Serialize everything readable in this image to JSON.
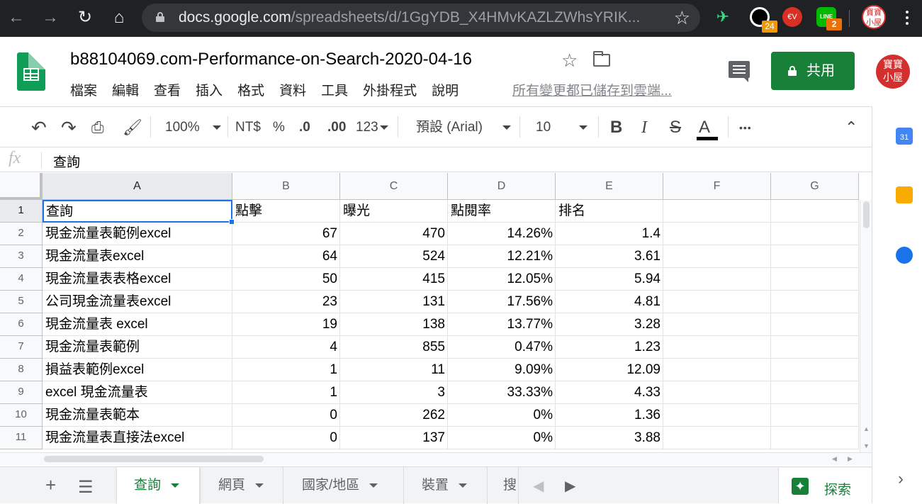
{
  "browser": {
    "url_host": "docs.google.com",
    "url_path": "/spreadsheets/d/1GgYDB_X4HMvKAZLZWhsYRIK...",
    "ext_badge_1": "24",
    "ext_badge_2": "2",
    "ext_label_line": "LINE",
    "ext_label_ev": "€V",
    "profile_text": "寶寶\n小屋"
  },
  "doc": {
    "title": "b88104069.com-Performance-on-Search-2020-04-16",
    "save_status": "所有變更都已儲存到雲端...",
    "share_label": "共用",
    "avatar_text": "寶寶\n小屋",
    "menu": [
      "檔案",
      "編輯",
      "查看",
      "插入",
      "格式",
      "資料",
      "工具",
      "外掛程式",
      "說明"
    ]
  },
  "toolbar": {
    "zoom": "100%",
    "currency": "NT$",
    "percent": "%",
    "dec_decrease": ".0",
    "dec_increase": ".00",
    "more_formats": "123",
    "font": "預設 (Arial)",
    "font_size": "10",
    "bold": "B",
    "italic": "I",
    "strike": "S",
    "text_color": "A",
    "more": "•••"
  },
  "formula": {
    "fx": "fx",
    "content": "查詢"
  },
  "grid": {
    "columns": [
      "A",
      "B",
      "C",
      "D",
      "E",
      "F",
      "G"
    ],
    "rows": [
      {
        "n": "1",
        "cells": [
          "查詢",
          "點擊",
          "曝光",
          "點閱率",
          "排名"
        ]
      },
      {
        "n": "2",
        "cells": [
          "現金流量表範例excel",
          "67",
          "470",
          "14.26%",
          "1.4"
        ]
      },
      {
        "n": "3",
        "cells": [
          "現金流量表excel",
          "64",
          "524",
          "12.21%",
          "3.61"
        ]
      },
      {
        "n": "4",
        "cells": [
          "現金流量表表格excel",
          "50",
          "415",
          "12.05%",
          "5.94"
        ]
      },
      {
        "n": "5",
        "cells": [
          "公司現金流量表excel",
          "23",
          "131",
          "17.56%",
          "4.81"
        ]
      },
      {
        "n": "6",
        "cells": [
          "現金流量表 excel",
          "19",
          "138",
          "13.77%",
          "3.28"
        ]
      },
      {
        "n": "7",
        "cells": [
          "現金流量表範例",
          "4",
          "855",
          "0.47%",
          "1.23"
        ]
      },
      {
        "n": "8",
        "cells": [
          "損益表範例excel",
          "1",
          "11",
          "9.09%",
          "12.09"
        ]
      },
      {
        "n": "9",
        "cells": [
          "excel 現金流量表",
          "1",
          "3",
          "33.33%",
          "4.33"
        ]
      },
      {
        "n": "10",
        "cells": [
          "現金流量表範本",
          "0",
          "262",
          "0%",
          "1.36"
        ]
      },
      {
        "n": "11",
        "cells": [
          "現金流量表直接法excel",
          "0",
          "137",
          "0%",
          "3.88"
        ]
      }
    ]
  },
  "tabs": {
    "sheets": [
      "查詢",
      "網頁",
      "國家/地區",
      "裝置",
      "搜"
    ],
    "explore_label": "探索"
  },
  "colors": {
    "accent_green": "#188038",
    "selection_blue": "#1a73e8",
    "chrome_dark": "#202124"
  }
}
